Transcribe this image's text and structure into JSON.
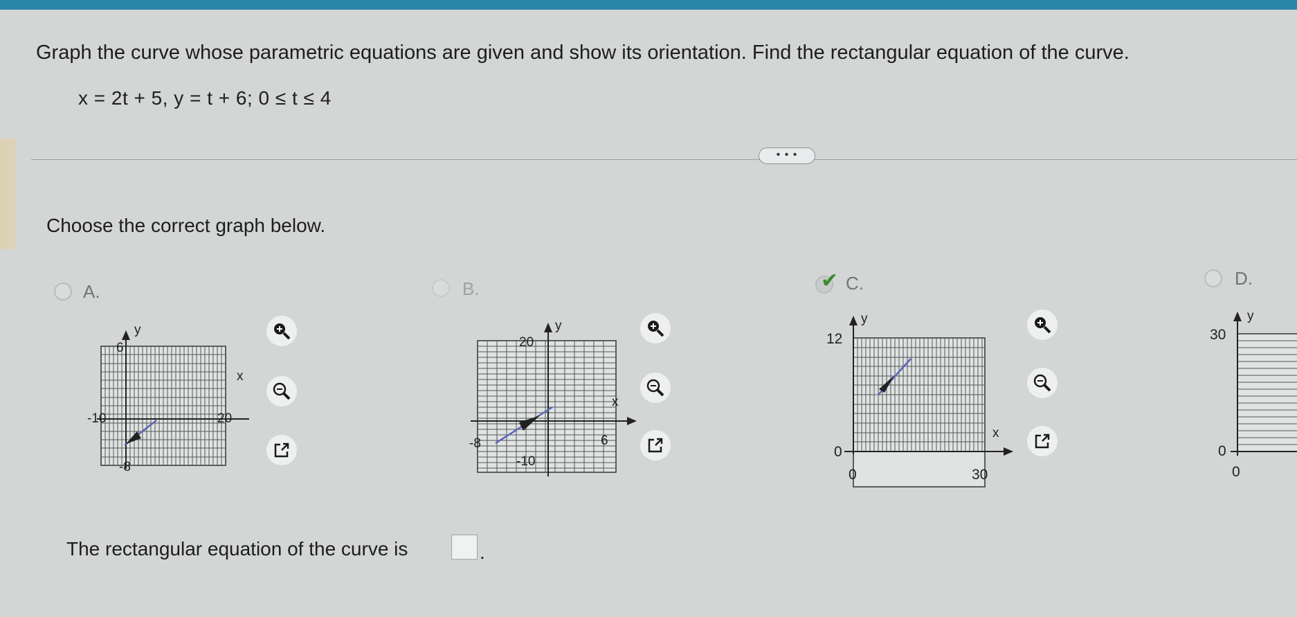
{
  "question": {
    "prompt": "Graph the curve whose parametric equations are given and show its orientation. Find the rectangular equation of the curve.",
    "equation": "x = 2t + 5,  y = t + 6;   0 ≤ t ≤ 4"
  },
  "more_button": "• • •",
  "choose_label": "Choose the correct graph below.",
  "options": [
    {
      "label": "A.",
      "x_neg": "-10",
      "x_pos": "20",
      "y_pos": "6",
      "y_neg": "-8",
      "x_axis": "x",
      "y_axis": "y"
    },
    {
      "label": "B.",
      "x_neg": "-8",
      "x_pos": "6",
      "y_pos": "20",
      "y_neg": "-10",
      "x_axis": "x",
      "y_axis": "y"
    },
    {
      "label": "C.",
      "x_min": "0",
      "x_max": "30",
      "y_min": "0",
      "y_max": "12",
      "x_axis": "x",
      "y_axis": "y"
    },
    {
      "label": "D.",
      "x_min": "0",
      "y_min": "0",
      "y_max": "30",
      "y_axis": "y"
    }
  ],
  "answer": {
    "prefix": "The rectangular equation of the curve is",
    "suffix": "."
  },
  "colors": {
    "curve": "#5a64b8",
    "correct_check": "#3c8a2b",
    "topbar": "#2a86a8"
  },
  "icons": [
    "zoom-in-icon",
    "zoom-out-icon",
    "pop-out-icon",
    "checkmark-icon"
  ]
}
